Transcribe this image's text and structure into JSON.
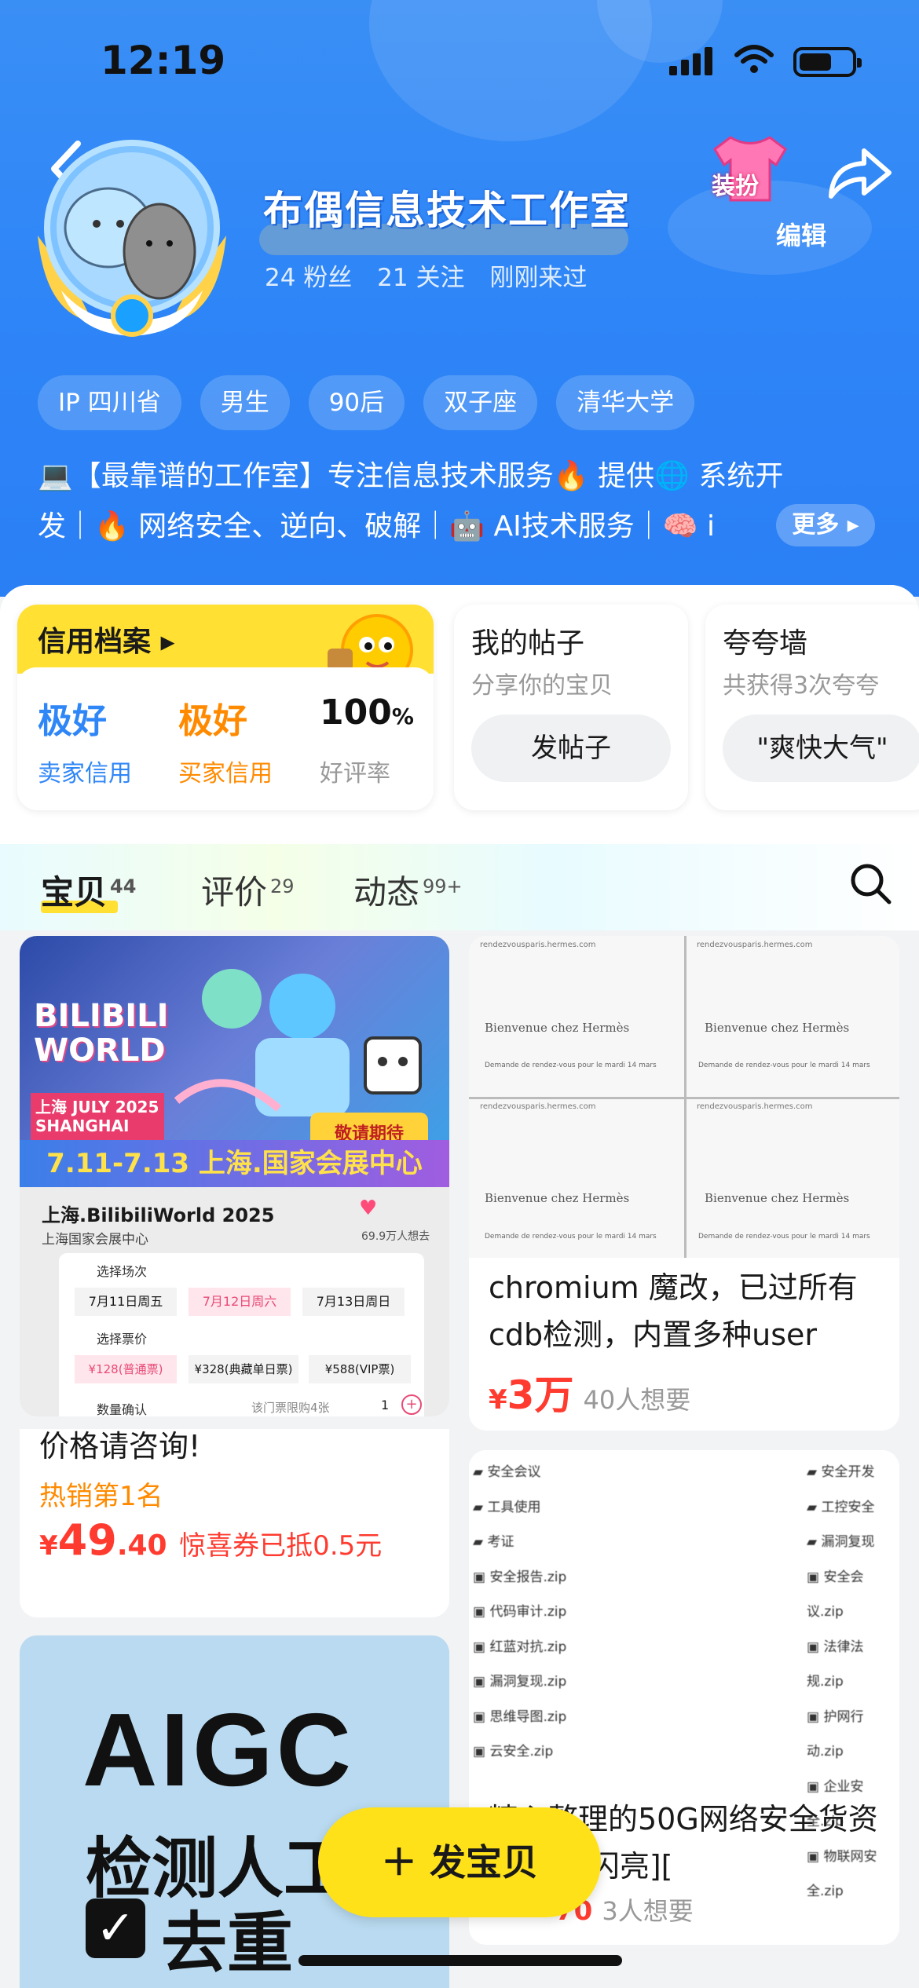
{
  "status": {
    "time": "12:19"
  },
  "profile": {
    "name": "布偶信息技术工作室",
    "stats": [
      "24 粉丝",
      "21 关注",
      "刚刚来过"
    ],
    "dress_label": "装扮",
    "edit_label": "编辑",
    "tags": [
      "IP 四川省",
      "男生",
      "90后",
      "双子座",
      "清华大学"
    ],
    "bio_line1": "💻【最靠谱的工作室】专注信息技术服务🔥   提供🌐 系统开",
    "bio_line2": "发｜🔥 网络安全、逆向、破解｜🤖 AI技术服务｜🧠 i",
    "more": "更多"
  },
  "credit": {
    "title": "信用档案",
    "seller_value": "极好",
    "seller_label": "卖家信用",
    "buyer_value": "极好",
    "buyer_label": "买家信用",
    "rate_value": "100",
    "rate_unit": "%",
    "rate_label": "好评率"
  },
  "posts": {
    "title": "我的帖子",
    "subtitle": "分享你的宝贝",
    "button": "发帖子"
  },
  "praise": {
    "title": "夸夸墙",
    "subtitle": "共获得3次夸夸",
    "button": "\"爽快大气\""
  },
  "tabs": [
    {
      "label": "宝贝",
      "count": "44"
    },
    {
      "label": "评价",
      "count": "29"
    },
    {
      "label": "动态",
      "count": "99+"
    }
  ],
  "items": [
    {
      "title": "价格请咨询!",
      "badge": "热销第1名",
      "price_symbol": "¥",
      "price_int": "49",
      "price_dec": ".40",
      "coupon": "惊喜券已抵0.5元",
      "thumb": {
        "brand": "BILIBILI WORLD",
        "city": "上海 JULY 2025 SHANGHAI",
        "banner": "7.11-7.13 上海.国家会展中心",
        "event": "上海.BilibiliWorld 2025",
        "venue": "上海国家会展中心",
        "want": "69.9万人想去",
        "select_session": "选择场次",
        "sessions": [
          "7月11日周五",
          "7月12日周六",
          "7月13日周日"
        ],
        "select_price": "选择票价",
        "prices": [
          "¥128(普通票)",
          "¥328(典藏单日票)",
          "¥588(VIP票)"
        ],
        "qty_label": "数量确认",
        "limit": "该门票限购4张",
        "qty": "1",
        "stamp": "敬请期待"
      }
    },
    {
      "title": "chromium 魔改，已过所有cdb检测，内置多种user",
      "price_symbol": "¥",
      "price_int": "3万",
      "want": "40人想要",
      "thumb": {
        "heading": "Bienvenue chez Hermès",
        "line": "Demande de rendez-vous pour le mardi 14 mars",
        "url": "rendezvousparis.hermes.com"
      }
    },
    {
      "title": "精心整理的50G网络安全货资料来了[闪亮][",
      "price_tail": "70",
      "want": "3人想要",
      "thumb": {
        "left": [
          "安全会议",
          "工具使用",
          "考证",
          "安全报告.zip",
          "代码审计.zip",
          "红蓝对抗.zip",
          "漏洞复现.zip",
          "思维导图.zip",
          "云安全.zip"
        ],
        "right": [
          "安全开发",
          "工控安全",
          "漏洞复现",
          "安全会议.zip",
          "法律法规.zip",
          "护网行动.zip",
          "企业安全.zip",
          "物联网安全.zip"
        ]
      }
    },
    {
      "thumb": {
        "big": "AIGC",
        "line2": "检测人工",
        "line3": "去重"
      }
    }
  ],
  "fab": {
    "label": "发宝贝"
  },
  "colors": {
    "brand_blue": "#2f86f7",
    "accent_yellow": "#ffe033",
    "price_red": "#ff3b30",
    "seller_blue": "#2f86f7",
    "buyer_orange": "#ff8a00"
  }
}
